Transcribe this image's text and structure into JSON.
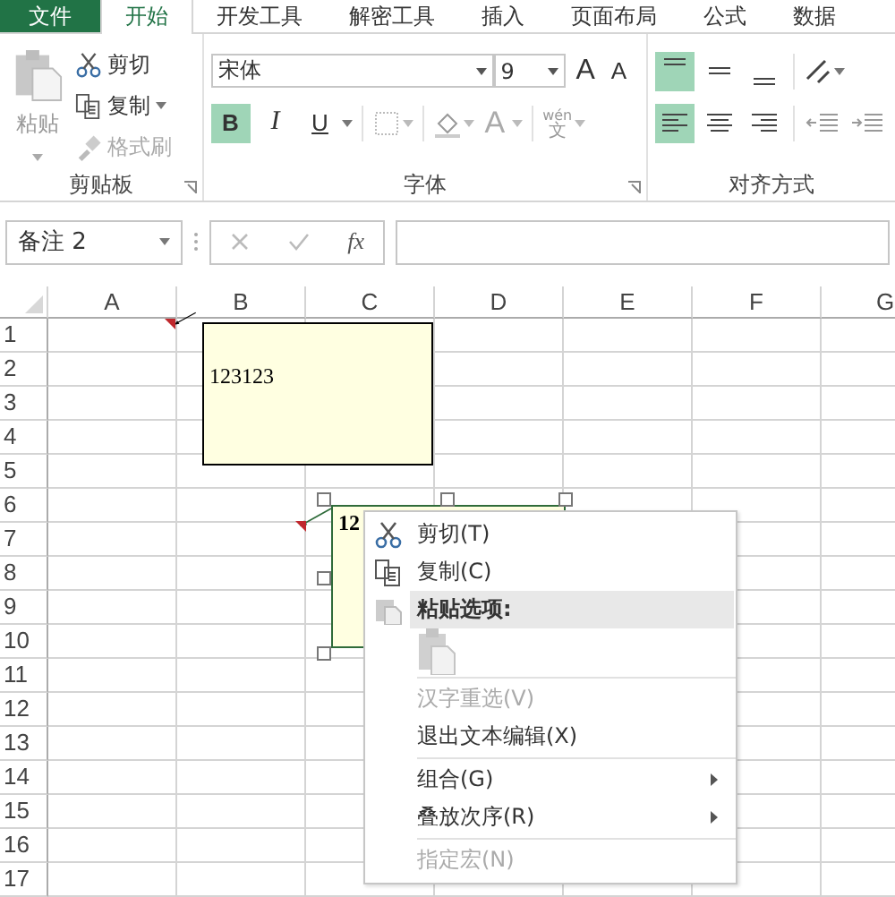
{
  "tabs": [
    {
      "label": "文件",
      "kind": "file",
      "selected": false
    },
    {
      "label": "开始",
      "kind": "tab",
      "selected": true
    },
    {
      "label": "开发工具",
      "kind": "tab",
      "selected": false
    },
    {
      "label": "解密工具",
      "kind": "tab",
      "selected": false
    },
    {
      "label": "插入",
      "kind": "tab",
      "selected": false
    },
    {
      "label": "页面布局",
      "kind": "tab",
      "selected": false
    },
    {
      "label": "公式",
      "kind": "tab",
      "selected": false
    },
    {
      "label": "数据",
      "kind": "tab",
      "selected": false
    }
  ],
  "ribbon": {
    "clipboard": {
      "label": "剪贴板",
      "paste": "粘贴",
      "items": [
        {
          "kind": "cut",
          "label": "剪切",
          "disabled": false
        },
        {
          "kind": "copy",
          "label": "复制",
          "disabled": false
        },
        {
          "kind": "painter",
          "label": "格式刷",
          "disabled": true
        }
      ]
    },
    "font": {
      "label": "字体",
      "font_name": "宋体",
      "font_size": "9",
      "grow": "A",
      "shrink": "A",
      "styles": [
        {
          "kind": "bold",
          "label": "B",
          "selected": true
        },
        {
          "kind": "italic",
          "label": "I",
          "selected": false
        },
        {
          "kind": "underline",
          "label": "U",
          "selected": false
        }
      ],
      "font_color": "A",
      "phonetic_top": "wén",
      "phonetic_bottom": "文"
    },
    "alignment": {
      "label": "对齐方式",
      "vertical": [
        {
          "kind": "top",
          "selected": true
        },
        {
          "kind": "middle",
          "selected": false
        },
        {
          "kind": "bottom",
          "selected": false
        }
      ],
      "horizontal": [
        {
          "kind": "left",
          "selected": true
        },
        {
          "kind": "center",
          "selected": false
        },
        {
          "kind": "right",
          "selected": false
        }
      ]
    }
  },
  "formula_bar": {
    "name_box": "备注 2",
    "fx": "fx"
  },
  "sheet": {
    "columns": [
      "A",
      "B",
      "C",
      "D",
      "E",
      "F",
      "G"
    ],
    "rows": [
      "1",
      "2",
      "3",
      "4",
      "5",
      "6",
      "7",
      "8",
      "9",
      "10",
      "11",
      "12",
      "13",
      "14",
      "15",
      "16",
      "17"
    ],
    "comments": [
      {
        "text": "123123",
        "bold": false,
        "selected": false
      },
      {
        "text": "12",
        "bold": true,
        "selected": true
      }
    ]
  },
  "context_menu": {
    "items": [
      {
        "kind": "cut",
        "label": "剪切(T)",
        "disabled": false,
        "submenu": false
      },
      {
        "kind": "copy",
        "label": "复制(C)",
        "disabled": false,
        "submenu": false
      },
      {
        "kind": "header",
        "label": "粘贴选项:"
      },
      {
        "kind": "paste_options"
      },
      {
        "kind": "separator"
      },
      {
        "kind": "item",
        "label": "汉字重选(V)",
        "disabled": true,
        "submenu": false
      },
      {
        "kind": "item",
        "label": "退出文本编辑(X)",
        "disabled": false,
        "submenu": false
      },
      {
        "kind": "separator"
      },
      {
        "kind": "item",
        "label": "组合(G)",
        "disabled": false,
        "submenu": true
      },
      {
        "kind": "item",
        "label": "叠放次序(R)",
        "disabled": false,
        "submenu": true
      },
      {
        "kind": "separator"
      },
      {
        "kind": "item",
        "label": "指定宏(N)",
        "disabled": true,
        "submenu": false
      }
    ]
  }
}
